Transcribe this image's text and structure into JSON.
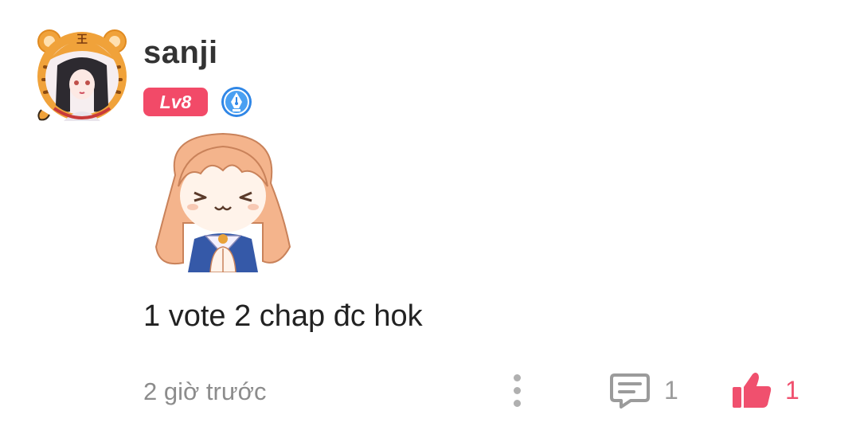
{
  "comment": {
    "username": "sanji",
    "level_label": "Lv8",
    "text": "1 vote 2 chap đc hok",
    "timestamp": "2 giờ trước",
    "reply_count": "1",
    "like_count": "1"
  },
  "avatar": {
    "icon": "tiger-hat-avatar",
    "frame_color": "#f0a23a"
  },
  "badges": {
    "pen_badge_icon": "fountain-pen-icon",
    "level_color": "#f24a68"
  },
  "sticker": {
    "icon": "anime-girl-praying-sticker"
  },
  "actions": {
    "more_icon": "more-vertical-icon",
    "reply_icon": "comment-bubble-icon",
    "like_icon": "thumbs-up-icon",
    "like_color": "#f0506e"
  }
}
